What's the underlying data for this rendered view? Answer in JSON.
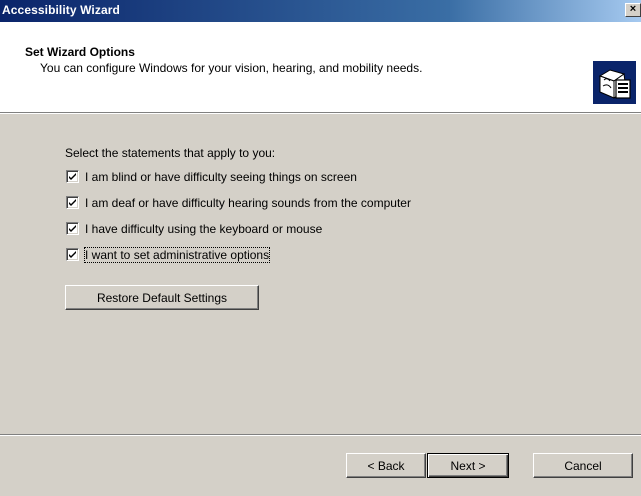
{
  "window": {
    "title": "Accessibility Wizard",
    "close_label": "×"
  },
  "header": {
    "title": "Set Wizard Options",
    "subtitle": "You can configure Windows for your vision, hearing, and mobility needs.",
    "icon": "accessibility-wizard-icon"
  },
  "main": {
    "prompt": "Select the statements that apply to you:",
    "options": [
      {
        "label": "I am blind or have difficulty seeing things on screen",
        "checked": true
      },
      {
        "label": "I am deaf or have difficulty hearing sounds from the computer",
        "checked": true
      },
      {
        "label": "I have difficulty using the keyboard or mouse",
        "checked": true
      },
      {
        "label": "I want to set administrative options",
        "checked": true,
        "focused": true
      }
    ],
    "restore_button": "Restore Default Settings"
  },
  "footer": {
    "back_button": "< Back",
    "next_button": "Next >",
    "cancel_button": "Cancel"
  }
}
